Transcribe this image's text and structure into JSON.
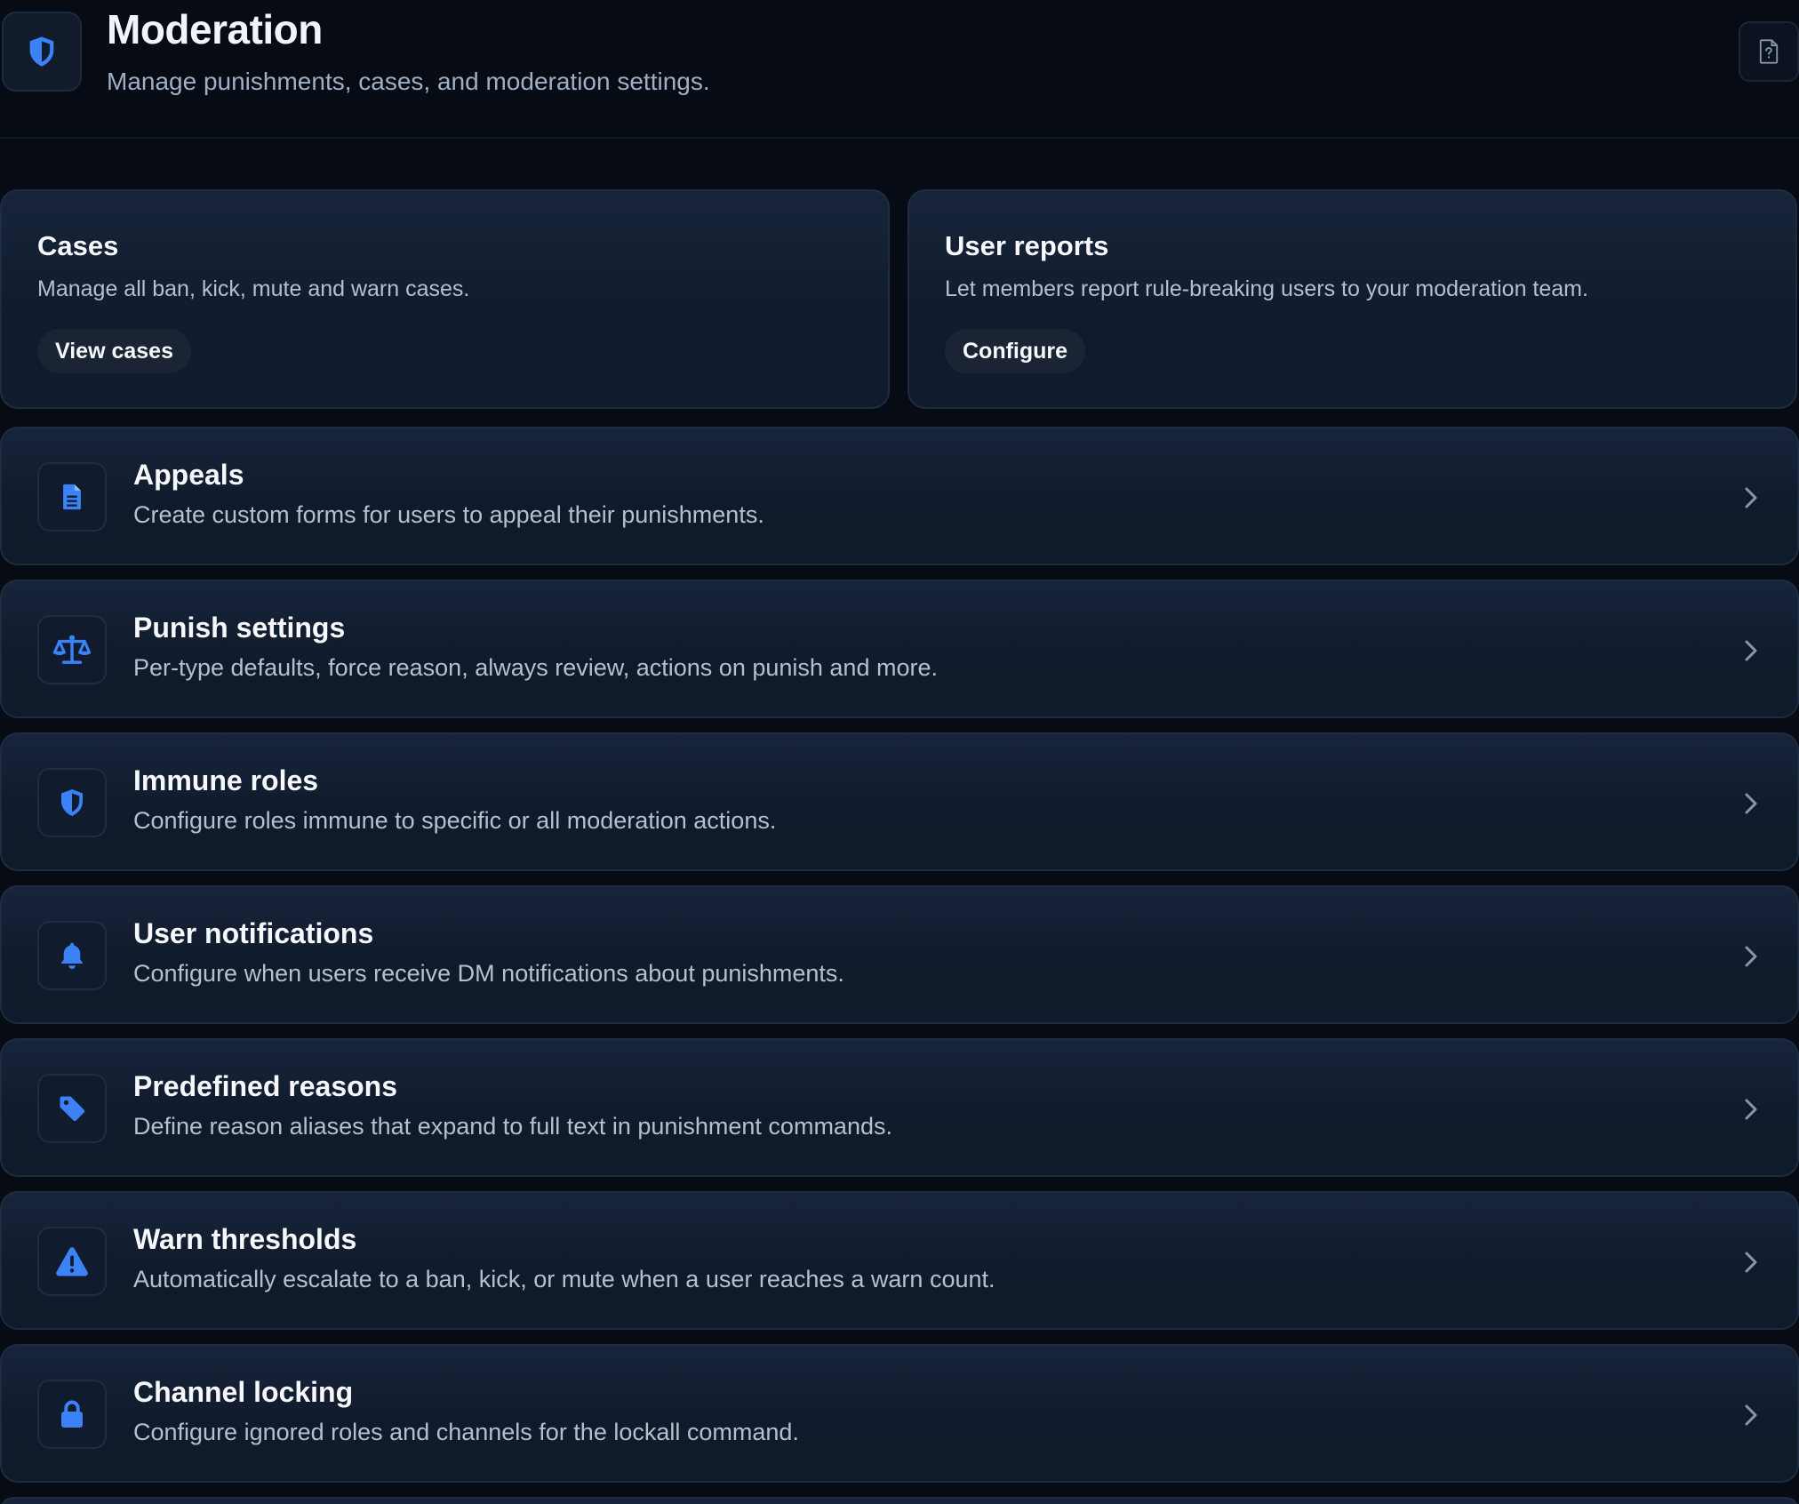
{
  "header": {
    "title": "Moderation",
    "subtitle": "Manage punishments, cases, and moderation settings."
  },
  "cards": [
    {
      "title": "Cases",
      "description": "Manage all ban, kick, mute and warn cases.",
      "button": "View cases"
    },
    {
      "title": "User reports",
      "description": "Let members report rule-breaking users to your moderation team.",
      "button": "Configure"
    }
  ],
  "settings": [
    {
      "icon": "document-icon",
      "title": "Appeals",
      "description": "Create custom forms for users to appeal their punishments."
    },
    {
      "icon": "scales-icon",
      "title": "Punish settings",
      "description": "Per-type defaults, force reason, always review, actions on punish and more."
    },
    {
      "icon": "shield-icon",
      "title": "Immune roles",
      "description": "Configure roles immune to specific or all moderation actions."
    },
    {
      "icon": "bell-icon",
      "title": "User notifications",
      "description": "Configure when users receive DM notifications about punishments."
    },
    {
      "icon": "tag-icon",
      "title": "Predefined reasons",
      "description": "Define reason aliases that expand to full text in punishment commands."
    },
    {
      "icon": "warning-icon",
      "title": "Warn thresholds",
      "description": "Automatically escalate to a ban, kick, or mute when a user reaches a warn count."
    },
    {
      "icon": "lock-icon",
      "title": "Channel locking",
      "description": "Configure ignored roles and channels for the lockall command."
    }
  ],
  "colors": {
    "accent": "#3b82f6",
    "background": "#060b14",
    "card": "#131f33"
  }
}
